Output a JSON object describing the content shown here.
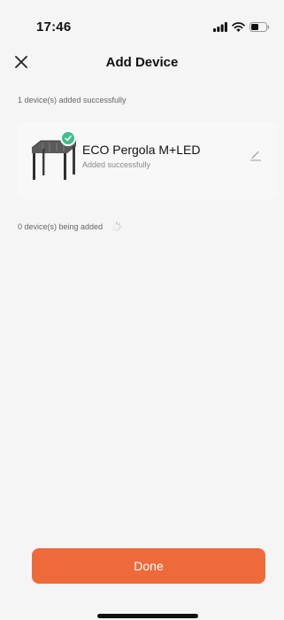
{
  "status_bar": {
    "time": "17:46",
    "icons": [
      "signal-icon",
      "wifi-icon",
      "battery-icon"
    ]
  },
  "header": {
    "title": "Add Device",
    "close_icon": "close-icon"
  },
  "success_section": {
    "label": "1 device(s) added successfully",
    "devices": [
      {
        "name": "ECO Pergola M+LED",
        "status": "Added successfully",
        "icon": "pergola-icon",
        "badge_icon": "check-icon",
        "edit_icon": "edit-icon"
      }
    ]
  },
  "adding_section": {
    "label": "0 device(s) being added",
    "icon": "loading-spinner-icon"
  },
  "footer": {
    "done_label": "Done"
  },
  "colors": {
    "accent": "#ee6a3b",
    "success": "#3fbf8a",
    "background": "#f5f5f5"
  }
}
